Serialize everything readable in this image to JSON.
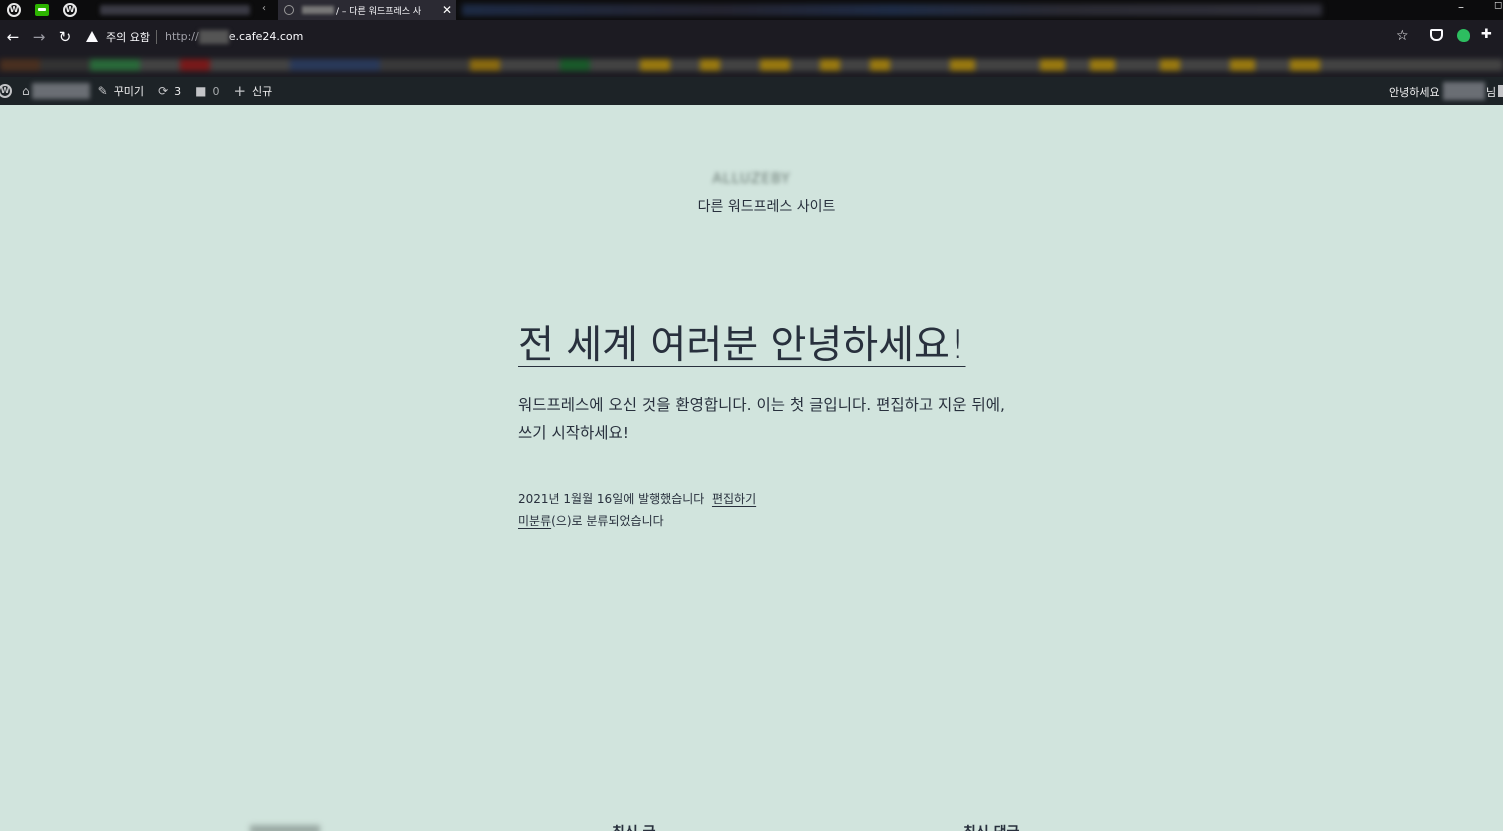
{
  "browser": {
    "active_tab_title": "/ – 다른 워드프레스 사",
    "address_warning": "주의 요함",
    "url_protocol": "http://",
    "url_host": "e.cafe24.com"
  },
  "adminbar": {
    "customize_label": "꾸미기",
    "updates_count": "3",
    "comments_count": "0",
    "new_label": "신규",
    "greeting": "안녕하세요",
    "greeting_suffix": "님"
  },
  "site": {
    "title": "ALLUZEBY",
    "description": "다른 워드프레스 사이트"
  },
  "post": {
    "title": "전 세계 여러분 안녕하세요!",
    "body": "워드프레스에 오신 것을 환영합니다. 이는 첫 글입니다. 편집하고 지운 뒤에, 쓰기 시작하세요!",
    "published_text": "2021년 1월월 16일에 발행했습니다",
    "edit_link": "편집하기",
    "category_link": "미분류",
    "category_suffix": "(으)로 분류되었습니다"
  },
  "footer": {
    "recent_posts_heading": "최신 글",
    "recent_comments_heading": "최신 댓글"
  },
  "colors": {
    "page_background": "#d1e4dd",
    "text": "#28303d",
    "adminbar": "#1d2327"
  }
}
